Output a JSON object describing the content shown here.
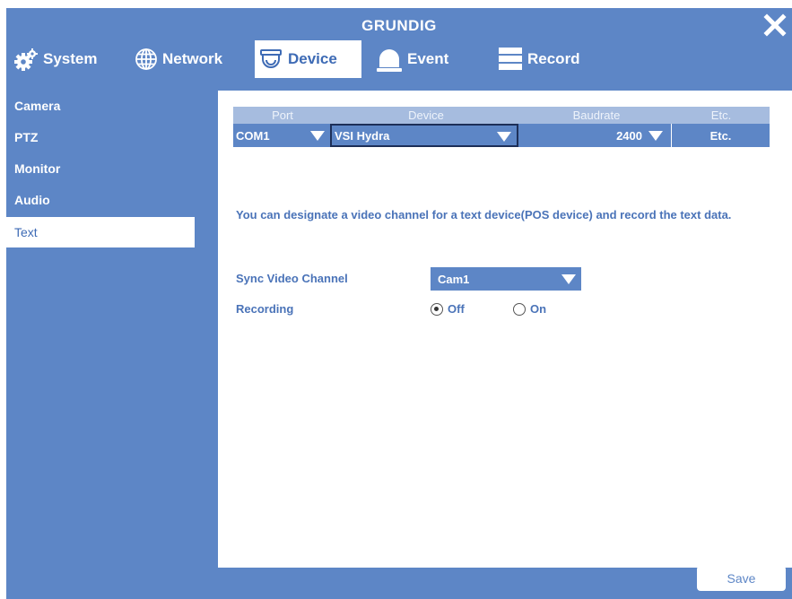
{
  "app": {
    "title": "GRUNDIG"
  },
  "tabs": [
    {
      "label": "System",
      "icon": "gears-icon"
    },
    {
      "label": "Network",
      "icon": "globe-icon"
    },
    {
      "label": "Device",
      "icon": "dome-camera-icon",
      "active": true
    },
    {
      "label": "Event",
      "icon": "alarm-bell-icon"
    },
    {
      "label": "Record",
      "icon": "record-storage-icon"
    }
  ],
  "sidebar": {
    "items": [
      {
        "label": "Camera"
      },
      {
        "label": "PTZ"
      },
      {
        "label": "Monitor"
      },
      {
        "label": "Audio"
      },
      {
        "label": "Text",
        "active": true
      }
    ]
  },
  "port_table": {
    "headers": {
      "port": "Port",
      "device": "Device",
      "baudrate": "Baudrate",
      "etc": "Etc."
    },
    "row": {
      "port": "COM1",
      "device": "VSI Hydra",
      "baudrate": "2400",
      "etc": "Etc."
    }
  },
  "description": "You can designate a video channel for a text device(POS device) and record the text data.",
  "form": {
    "sync_label": "Sync Video Channel",
    "sync_value": "Cam1",
    "recording_label": "Recording",
    "recording_options": [
      {
        "label": "Off",
        "checked": true
      },
      {
        "label": "On",
        "checked": false
      }
    ]
  },
  "footer": {
    "save_label": "Save"
  },
  "colors": {
    "panel_blue": "#5d86c6",
    "header_light": "#a6bcdf",
    "text_blue": "#4a73b8",
    "background": "#ffffff"
  }
}
